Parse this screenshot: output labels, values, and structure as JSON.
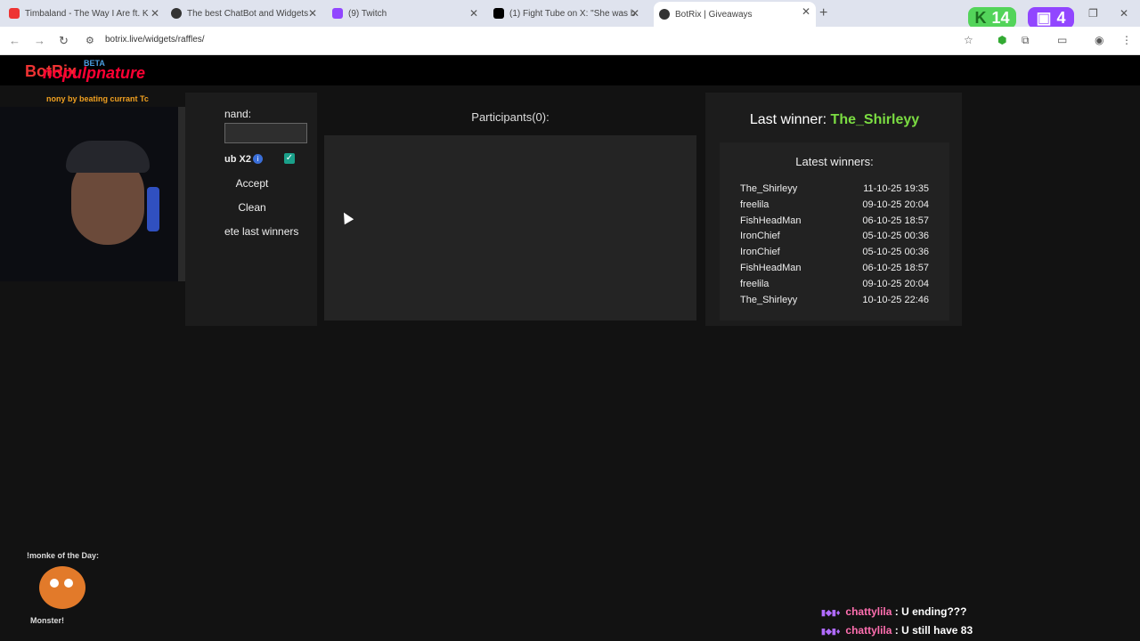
{
  "browser": {
    "tabs": [
      {
        "label": "Timbaland - The Way I Are ft. K",
        "color": "#e33"
      },
      {
        "label": "The best ChatBot and Widgets",
        "color": "#333"
      },
      {
        "label": "(9) Twitch",
        "color": "#9146ff"
      },
      {
        "label": "(1) Fight Tube on X: \"She was b",
        "color": "#000"
      },
      {
        "label": "BotRix | Giveaways",
        "color": "#333"
      }
    ],
    "url": "botrix.live/widgets/raffles/",
    "kick_count": "14",
    "twitch_count": "4"
  },
  "site": {
    "logo": "BotRix",
    "logo_overlay": "nopulpnature",
    "beta": "BETA",
    "overlay_text": "nony by beating currant Tc"
  },
  "controls": {
    "command_label": "nand:",
    "command_value": "",
    "sub_label": "ub X2",
    "info_icon": "i",
    "checkbox_mark": "✓",
    "accept": "Accept",
    "clean": "Clean",
    "delete_last": "ete last winners"
  },
  "participants": {
    "title": "Participants(0):"
  },
  "winners": {
    "last_label": "Last winner: ",
    "last_name": "The_Shirleyy",
    "latest_title": "Latest winners:",
    "list": [
      {
        "name": "The_Shirleyy",
        "date": "11-10-25 19:35"
      },
      {
        "name": "freelila",
        "date": "09-10-25 20:04"
      },
      {
        "name": "FishHeadMan",
        "date": "06-10-25 18:57"
      },
      {
        "name": "IronChief",
        "date": "05-10-25 00:36"
      },
      {
        "name": "IronChief",
        "date": "05-10-25 00:36"
      },
      {
        "name": "FishHeadMan",
        "date": "06-10-25 18:57"
      },
      {
        "name": "freelila",
        "date": "09-10-25 20:04"
      },
      {
        "name": "The_Shirleyy",
        "date": "10-10-25 22:46"
      }
    ]
  },
  "stream": {
    "monke_label": "!monke of the Day:",
    "monke_name": "Monster!"
  },
  "chat": [
    {
      "badges": "▮◆▮♦",
      "user": "chattylila",
      "text": " : U ending???"
    },
    {
      "badges": "▮◆▮♦",
      "user": "chattylila",
      "text": " : U still have 83"
    }
  ]
}
